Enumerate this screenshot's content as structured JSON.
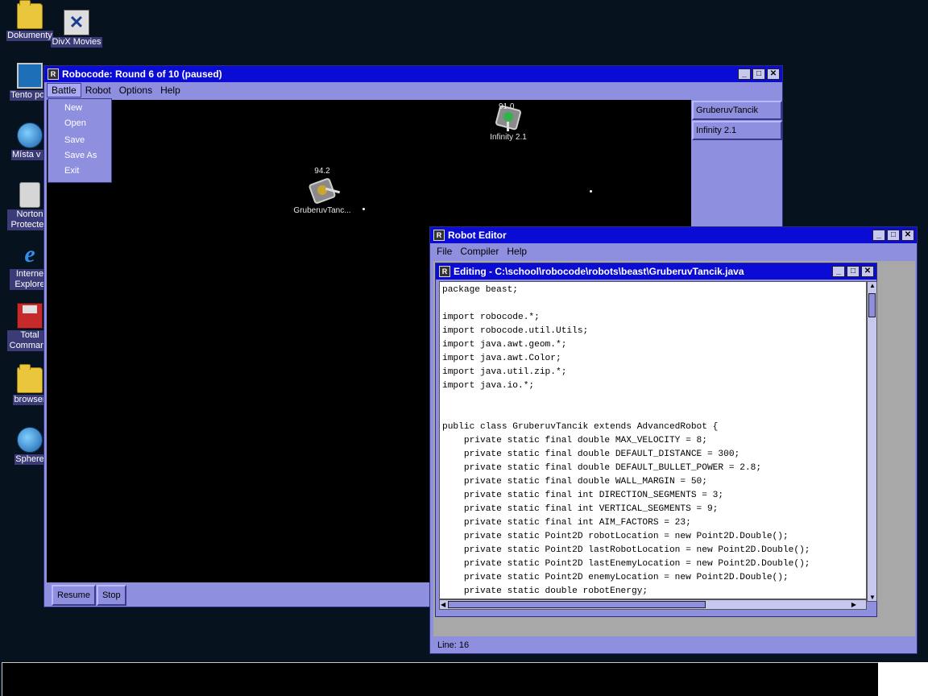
{
  "desktop": {
    "icons": [
      {
        "label": "Dokumenty",
        "icon": "folder-icon"
      },
      {
        "label": "DivX Movies",
        "icon": "divx-icon"
      },
      {
        "label": "Tento poč",
        "icon": "computer-icon"
      },
      {
        "label": "Místa v s",
        "icon": "network-places-icon"
      },
      {
        "label": "Norton Protected",
        "icon": "recycle-bin-icon"
      },
      {
        "label": "Interne Explore",
        "icon": "internet-explorer-icon"
      },
      {
        "label": "Total Command",
        "icon": "total-commander-icon"
      },
      {
        "label": "browser",
        "icon": "folder-icon"
      },
      {
        "label": "Sphere",
        "icon": "sphere-icon"
      }
    ]
  },
  "robocode": {
    "title": "Robocode: Round 6 of 10 (paused)",
    "menu": [
      "Battle",
      "Robot",
      "Options",
      "Help"
    ],
    "battle_menu": [
      "New",
      "Open",
      "Save",
      "Save As",
      "Exit"
    ],
    "robots": [
      {
        "name": "GruberuvTanc...",
        "energy": "94.2"
      },
      {
        "name": "Infinity 2.1",
        "energy": "91.0"
      }
    ],
    "robot_buttons": [
      "GruberuvTancik",
      "Infinity 2.1"
    ],
    "controls": {
      "resume": "Resume",
      "stop": "Stop"
    }
  },
  "editor": {
    "title": "Robot Editor",
    "menu": [
      "File",
      "Compiler",
      "Help"
    ],
    "file_title": "Editing - C:\\school\\robocode\\robots\\beast\\GruberuvTancik.java",
    "code": "package beast;\n\nimport robocode.*;\nimport robocode.util.Utils;\nimport java.awt.geom.*;\nimport java.awt.Color;\nimport java.util.zip.*;\nimport java.io.*;\n\n\npublic class GruberuvTancik extends AdvancedRobot {\n    private static final double MAX_VELOCITY = 8;\n    private static final double DEFAULT_DISTANCE = 300;\n    private static final double DEFAULT_BULLET_POWER = 2.8;\n    private static final double WALL_MARGIN = 50;\n    private static final int DIRECTION_SEGMENTS = 3;\n    private static final int VERTICAL_SEGMENTS = 9;\n    private static final int AIM_FACTORS = 23;\n    private static Point2D robotLocation = new Point2D.Double();\n    private static Point2D lastRobotLocation = new Point2D.Double();\n    private static Point2D lastEnemyLocation = new Point2D.Double();\n    private static Point2D enemyLocation = new Point2D.Double();\n    private static double robotEnergy;\n    private static String enemyName = \"\";",
    "status": "Line: 16"
  }
}
